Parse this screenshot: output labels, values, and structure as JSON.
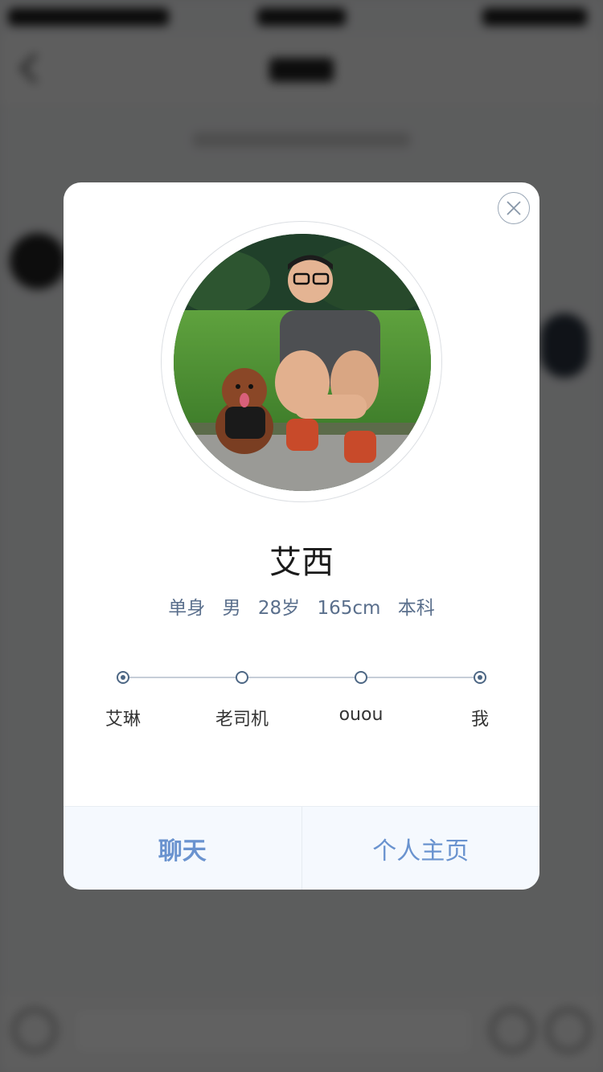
{
  "profile": {
    "name": "艾西",
    "info": [
      "单身",
      "男",
      "28岁",
      "165cm",
      "本科"
    ]
  },
  "timeline": {
    "items": [
      {
        "label": "艾琳",
        "filled": true
      },
      {
        "label": "老司机",
        "filled": false
      },
      {
        "label": "ouou",
        "filled": false
      },
      {
        "label": "我",
        "filled": true
      }
    ]
  },
  "actions": {
    "chat_label": "聊天",
    "homepage_label": "个人主页"
  },
  "icons": {
    "close": "close-icon"
  },
  "colors": {
    "accent": "#6a93cf",
    "info_text": "#5a6f8c",
    "timeline": "#4d6784",
    "overlay": "rgba(0,0,0,0.62)"
  }
}
